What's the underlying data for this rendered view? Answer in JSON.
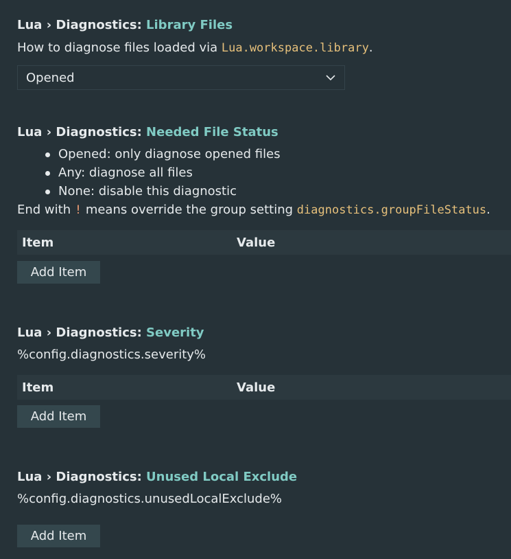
{
  "settings": [
    {
      "category": "Lua › Diagnostics: ",
      "name": "Library Files",
      "desc_prefix": "How to diagnose files loaded via ",
      "desc_code": "Lua.workspace.library",
      "desc_suffix": ".",
      "select_value": "Opened"
    },
    {
      "category": "Lua › Diagnostics: ",
      "name": "Needed File Status",
      "options": [
        "Opened: only diagnose opened files",
        "Any: diagnose all files",
        "None: disable this diagnostic"
      ],
      "desc_prefix": "End with ",
      "desc_code1": "!",
      "desc_mid": " means override the group setting ",
      "desc_code2": "diagnostics.groupFileStatus",
      "desc_suffix": ".",
      "col_item": "Item",
      "col_value": "Value",
      "add_label": "Add Item"
    },
    {
      "category": "Lua › Diagnostics: ",
      "name": "Severity",
      "desc": "%config.diagnostics.severity%",
      "col_item": "Item",
      "col_value": "Value",
      "add_label": "Add Item"
    },
    {
      "category": "Lua › Diagnostics: ",
      "name": "Unused Local Exclude",
      "desc": "%config.diagnostics.unusedLocalExclude%",
      "add_label": "Add Item"
    }
  ],
  "icons": {
    "dropdown": "chevron-down-icon"
  },
  "colors": {
    "background": "#263238",
    "accent": "#80cbc4",
    "code": "#e6c07b"
  }
}
